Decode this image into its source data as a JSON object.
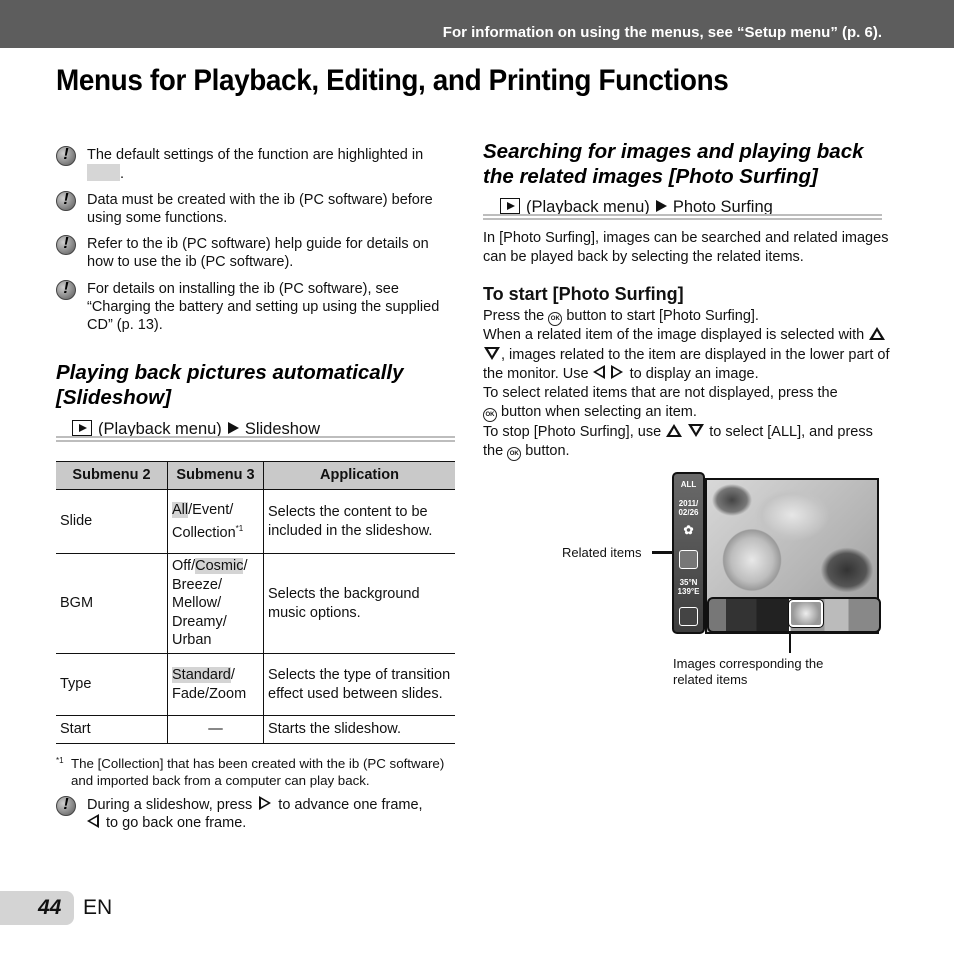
{
  "header": {
    "info_text": "For information on using the menus, see “Setup menu” (p. 6).",
    "bar_color": "#5d5d5d"
  },
  "page_title": "Menus for Playback, Editing, and Printing Functions",
  "notes": [
    {
      "icon": "caution-icon",
      "text": "The default settings of the function are highlighted in",
      "suffix": "."
    },
    {
      "icon": "caution-icon",
      "text": "Data must be created with the ib (PC software) before using some functions."
    },
    {
      "icon": "caution-icon",
      "text": "Refer to the ib (PC software) help guide for details on how to use the ib (PC software)."
    },
    {
      "icon": "caution-icon",
      "text": "For details on installing the ib (PC software), see “Charging the battery and setting up using the supplied CD” (p. 13)."
    }
  ],
  "slideshow": {
    "title_line1": "Playing back pictures automatically",
    "title_line2": "[Slideshow]",
    "menu_path": {
      "menu": "(Playback menu)",
      "item": "Slideshow"
    },
    "table": {
      "headers": [
        "Submenu 2",
        "Submenu 3",
        "Application"
      ],
      "rows": [
        {
          "submenu2": "Slide",
          "options": [
            {
              "text": "All",
              "default": true
            },
            {
              "text": "/Event/"
            },
            {
              "text": "Collection"
            }
          ],
          "footnote_mark": "*1",
          "application": "Selects the content to be included in the slideshow."
        },
        {
          "submenu2": "BGM",
          "options": [
            {
              "text": "Off/"
            },
            {
              "text": "Cosmic",
              "default": true
            },
            {
              "text": "/ Breeze/ Mellow/ Dreamy/ Urban"
            }
          ],
          "application": "Selects the background music options."
        },
        {
          "submenu2": "Type",
          "options": [
            {
              "text": "Standard",
              "default": true
            },
            {
              "text": "/ Fade/Zoom"
            }
          ],
          "application": "Selects the type of transition effect used between slides."
        },
        {
          "submenu2": "Start",
          "options": [
            {
              "text": "—"
            }
          ],
          "application": "Starts the slideshow."
        }
      ]
    },
    "footnote": {
      "mark": "*1",
      "text": "The [Collection] that has been created with the ib (PC software) and imported back from a computer can play back."
    },
    "tip": {
      "part1": "During a slideshow, press",
      "part2": "to advance one frame,",
      "part3": "to go back one frame."
    }
  },
  "photo_surfing": {
    "title_line1": "Searching for images and playing back",
    "title_line2": "the related images [Photo Surfing]",
    "menu_path": {
      "menu": "(Playback menu)",
      "item": "Photo Surfing"
    },
    "intro": "In [Photo Surfing], images can be searched and related images can be played back by selecting the related items.",
    "start_heading": "To start [Photo Surfing]",
    "steps": {
      "s1a": "Press the",
      "s1b": "button to start [Photo Surfing].",
      "s2a": "When a related item of the image displayed is selected with",
      "s2b": ", images related to the item are displayed in the lower part of the monitor. Use",
      "s2c": "to display an image.",
      "s3a": "To select related items that are not displayed, press the",
      "s3b": "button when selecting an item.",
      "s4a": "To stop [Photo Surfing], use",
      "s4b": "to select [ALL], and press the",
      "s4c": "button."
    },
    "ok_label": "OK",
    "diagram": {
      "side_panel": {
        "all": "ALL",
        "date_line1": "2011/",
        "date_line2": "02/26",
        "gps_line1": "35°N",
        "gps_line2": "139°E"
      },
      "label_related_items": "Related items",
      "label_images": "Images corresponding the related items"
    }
  },
  "footer": {
    "page_number": "44",
    "language": "EN"
  }
}
